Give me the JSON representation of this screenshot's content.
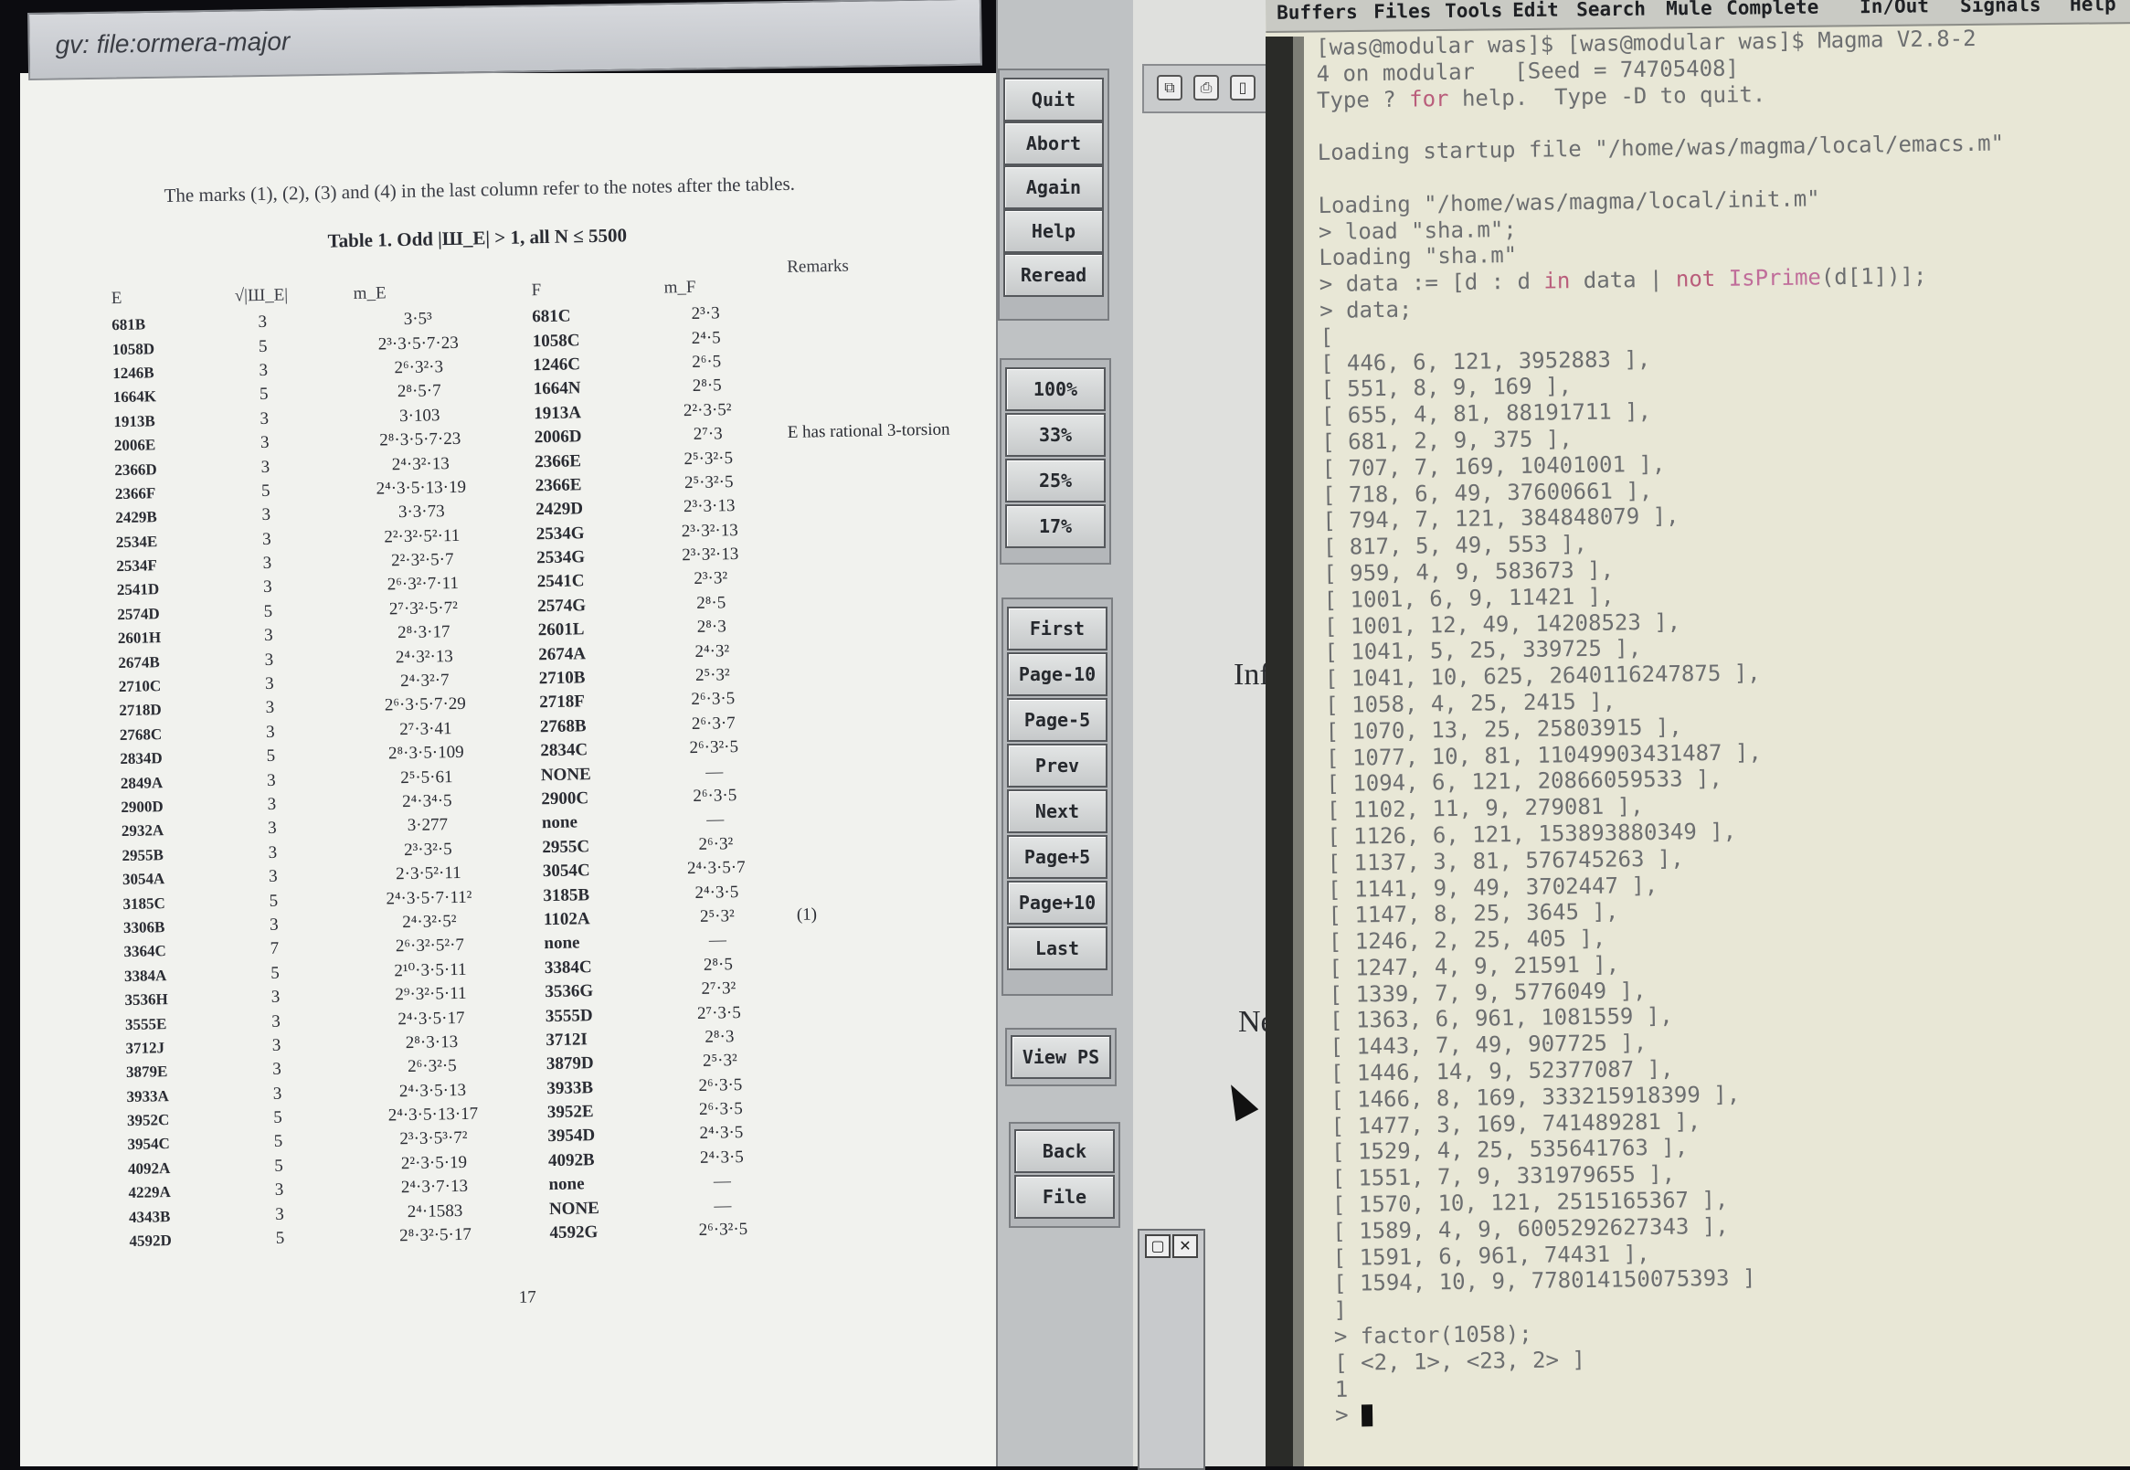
{
  "gv": {
    "title": "gv: file:ormera-major",
    "intro": "The marks (1), (2), (3) and (4) in the last column refer to the notes after the tables.",
    "caption": "Table 1. Odd |Ш_E| > 1, all N ≤ 5500",
    "headers": {
      "e": "E",
      "sha": "√|Ш_E|",
      "m_e": "m_E",
      "f": "F",
      "m_f": "m_F",
      "remarks": "Remarks"
    },
    "rows": [
      [
        "681B",
        "3",
        "3·5³",
        "681C",
        "2³·3",
        ""
      ],
      [
        "1058D",
        "5",
        "2³·3·5·7·23",
        "1058C",
        "2⁴·5",
        ""
      ],
      [
        "1246B",
        "3",
        "2⁶·3²·3",
        "1246C",
        "2⁶·5",
        ""
      ],
      [
        "1664K",
        "5",
        "2⁸·5·7",
        "1664N",
        "2⁸·5",
        ""
      ],
      [
        "1913B",
        "3",
        "3·103",
        "1913A",
        "2²·3·5²",
        ""
      ],
      [
        "2006E",
        "3",
        "2⁸·3·5·7·23",
        "2006D",
        "2⁷·3",
        "E has rational 3-torsion"
      ],
      [
        "2366D",
        "3",
        "2⁴·3²·13",
        "2366E",
        "2⁵·3²·5",
        ""
      ],
      [
        "2366F",
        "5",
        "2⁴·3·5·13·19",
        "2366E",
        "2⁵·3²·5",
        ""
      ],
      [
        "2429B",
        "3",
        "3·3·73",
        "2429D",
        "2³·3·13",
        ""
      ],
      [
        "2534E",
        "3",
        "2²·3²·5²·11",
        "2534G",
        "2³·3²·13",
        ""
      ],
      [
        "2534F",
        "3",
        "2²·3²·5·7",
        "2534G",
        "2³·3²·13",
        ""
      ],
      [
        "2541D",
        "3",
        "2⁶·3²·7·11",
        "2541C",
        "2³·3²",
        ""
      ],
      [
        "2574D",
        "5",
        "2⁷·3²·5·7²",
        "2574G",
        "2⁸·5",
        ""
      ],
      [
        "2601H",
        "3",
        "2⁸·3·17",
        "2601L",
        "2⁸·3",
        ""
      ],
      [
        "2674B",
        "3",
        "2⁴·3²·13",
        "2674A",
        "2⁴·3²",
        ""
      ],
      [
        "2710C",
        "3",
        "2⁴·3²·7",
        "2710B",
        "2⁵·3²",
        ""
      ],
      [
        "2718D",
        "3",
        "2⁶·3·5·7·29",
        "2718F",
        "2⁶·3·5",
        ""
      ],
      [
        "2768C",
        "3",
        "2⁷·3·41",
        "2768B",
        "2⁶·3·7",
        ""
      ],
      [
        "2834D",
        "5",
        "2⁸·3·5·109",
        "2834C",
        "2⁶·3²·5",
        ""
      ],
      [
        "2849A",
        "3",
        "2⁵·5·61",
        "NONE",
        "—",
        ""
      ],
      [
        "2900D",
        "3",
        "2⁴·3⁴·5",
        "2900C",
        "2⁶·3·5",
        ""
      ],
      [
        "2932A",
        "3",
        "3·277",
        "none",
        "—",
        ""
      ],
      [
        "2955B",
        "3",
        "2³·3²·5",
        "2955C",
        "2⁶·3²",
        ""
      ],
      [
        "3054A",
        "3",
        "2·3·5²·11",
        "3054C",
        "2⁴·3·5·7",
        ""
      ],
      [
        "3185C",
        "5",
        "2⁴·3·5·7·11²",
        "3185B",
        "2⁴·3·5",
        ""
      ],
      [
        "3306B",
        "3",
        "2⁴·3²·5²",
        "1102A",
        "2⁵·3²",
        "(1)"
      ],
      [
        "3364C",
        "7",
        "2⁶·3²·5²·7",
        "none",
        "—",
        ""
      ],
      [
        "3384A",
        "5",
        "2¹⁰·3·5·11",
        "3384C",
        "2⁸·5",
        ""
      ],
      [
        "3536H",
        "3",
        "2⁹·3²·5·11",
        "3536G",
        "2⁷·3²",
        ""
      ],
      [
        "3555E",
        "3",
        "2⁴·3·5·17",
        "3555D",
        "2⁷·3·5",
        ""
      ],
      [
        "3712J",
        "3",
        "2⁸·3·13",
        "3712I",
        "2⁸·3",
        ""
      ],
      [
        "3879E",
        "3",
        "2⁶·3²·5",
        "3879D",
        "2⁵·3²",
        ""
      ],
      [
        "3933A",
        "3",
        "2⁴·3·5·13",
        "3933B",
        "2⁶·3·5",
        ""
      ],
      [
        "3952C",
        "5",
        "2⁴·3·5·13·17",
        "3952E",
        "2⁶·3·5",
        ""
      ],
      [
        "3954C",
        "5",
        "2³·3·5³·7²",
        "3954D",
        "2⁴·3·5",
        ""
      ],
      [
        "4092A",
        "5",
        "2²·3·5·19",
        "4092B",
        "2⁴·3·5",
        ""
      ],
      [
        "4229A",
        "3",
        "2⁴·3·7·13",
        "none",
        "—",
        ""
      ],
      [
        "4343B",
        "3",
        "2⁴·1583",
        "NONE",
        "—",
        ""
      ],
      [
        "4592D",
        "5",
        "2⁸·3²·5·17",
        "4592G",
        "2⁶·3²·5",
        ""
      ]
    ],
    "page_number": "17",
    "buttons": {
      "top": [
        "Quit",
        "Abort",
        "Again",
        "Help",
        "Reread"
      ],
      "zoom": [
        "100%",
        "33%",
        "25%",
        "17%"
      ],
      "nav": [
        "First",
        "Page-10",
        "Page-5",
        "Prev",
        "Next",
        "Page+5",
        "Page+10",
        "Last"
      ],
      "view": [
        "View PS"
      ],
      "bottom": [
        "Back",
        "File"
      ]
    }
  },
  "strip": {
    "frag1": "Inf",
    "frag2": "Ne"
  },
  "emacs": {
    "menu": [
      "Buffers",
      "Files",
      "Tools",
      "Edit",
      "Search",
      "Mule",
      "Complete",
      "In/Out",
      "Signals",
      "Help"
    ],
    "lines": [
      "[was@modular was]$ [was@modular was]$ Magma V2.8-2",
      "4 on modular   [Seed = 74705408]",
      "Type ? for help.  Type <Ctrl>-D to quit.",
      "",
      "Loading startup file \"/home/was/magma/local/emacs.m\"",
      "",
      "Loading \"/home/was/magma/local/init.m\"",
      "> load \"sha.m\";",
      "Loading \"sha.m\"",
      "> data := [d : d in data | not IsPrime(d[1])];",
      "> data;",
      "[",
      "[ 446, 6, 121, 3952883 ],",
      "[ 551, 8, 9, 169 ],",
      "[ 655, 4, 81, 88191711 ],",
      "[ 681, 2, 9, 375 ],",
      "[ 707, 7, 169, 10401001 ],",
      "[ 718, 6, 49, 37600661 ],",
      "[ 794, 7, 121, 384848079 ],",
      "[ 817, 5, 49, 553 ],",
      "[ 959, 4, 9, 583673 ],",
      "[ 1001, 6, 9, 11421 ],",
      "[ 1001, 12, 49, 14208523 ],",
      "[ 1041, 5, 25, 339725 ],",
      "[ 1041, 10, 625, 2640116247875 ],",
      "[ 1058, 4, 25, 2415 ],",
      "[ 1070, 13, 25, 25803915 ],",
      "[ 1077, 10, 81, 11049903431487 ],",
      "[ 1094, 6, 121, 20866059533 ],",
      "[ 1102, 11, 9, 279081 ],",
      "[ 1126, 6, 121, 153893880349 ],",
      "[ 1137, 3, 81, 576745263 ],",
      "[ 1141, 9, 49, 3702447 ],",
      "[ 1147, 8, 25, 3645 ],",
      "[ 1246, 2, 25, 405 ],",
      "[ 1247, 4, 9, 21591 ],",
      "[ 1339, 7, 9, 5776049 ],",
      "[ 1363, 6, 961, 1081559 ],",
      "[ 1443, 7, 49, 907725 ],",
      "[ 1446, 14, 9, 52377087 ],",
      "[ 1466, 8, 169, 333215918399 ],",
      "[ 1477, 3, 169, 741489281 ],",
      "[ 1529, 4, 25, 535641763 ],",
      "[ 1551, 7, 9, 331979655 ],",
      "[ 1570, 10, 121, 2515165367 ],",
      "[ 1589, 4, 9, 6005292627343 ],",
      "[ 1591, 6, 961, 74431 ],",
      "[ 1594, 10, 9, 778014150075393 ]",
      "]",
      "> factor(1058);",
      "[ <2, 1>, <23, 2> ]",
      "1",
      "> "
    ]
  }
}
